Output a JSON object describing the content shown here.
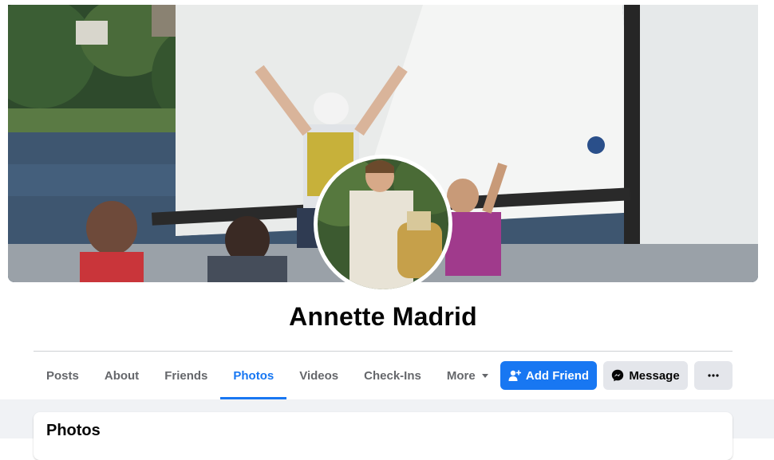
{
  "profile": {
    "name": "Annette Madrid"
  },
  "tabs": [
    {
      "label": "Posts"
    },
    {
      "label": "About"
    },
    {
      "label": "Friends"
    },
    {
      "label": "Photos",
      "active": true
    },
    {
      "label": "Videos"
    },
    {
      "label": "Check-Ins"
    },
    {
      "label": "More",
      "icon": "caret-down-icon"
    }
  ],
  "actions": {
    "add_friend": "Add Friend",
    "message": "Message",
    "more_icon": "ellipsis-icon"
  },
  "section": {
    "title": "Photos"
  },
  "colors": {
    "accent": "#1877f2",
    "secondary_button": "#e4e6eb",
    "page_background": "#f0f2f5"
  }
}
